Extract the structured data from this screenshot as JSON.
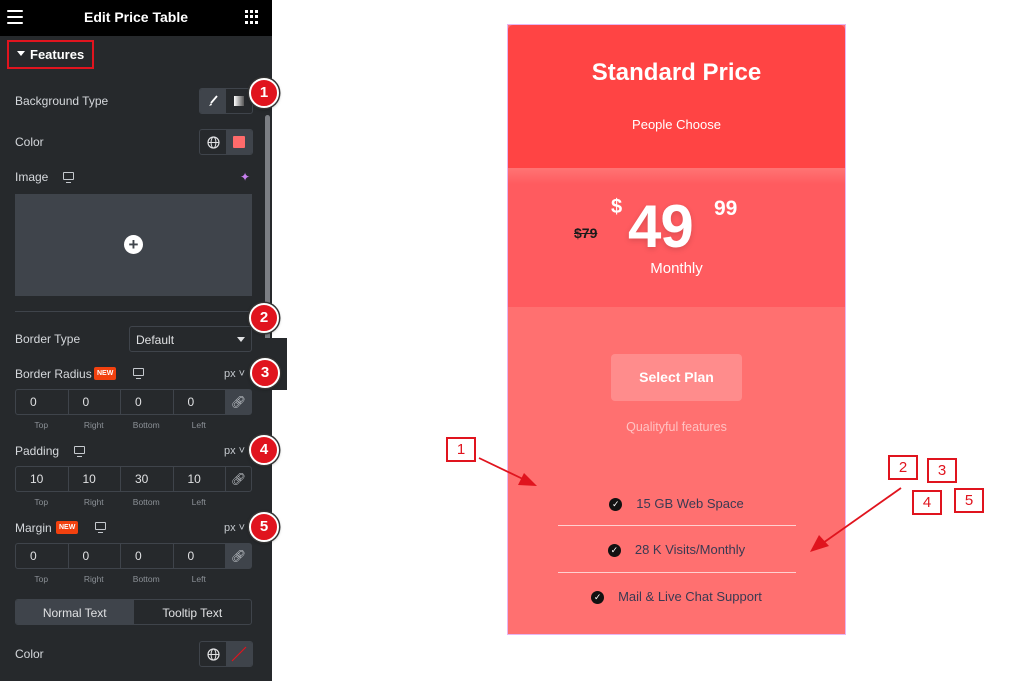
{
  "panel": {
    "header": {
      "title": "Edit Price Table",
      "menu_icon": "hamburger-icon",
      "apps_icon": "grid-icon"
    },
    "section_title": "Features",
    "background_type": {
      "label": "Background Type",
      "options": [
        "classic-brush-icon",
        "gradient-icon"
      ],
      "selected": "classic"
    },
    "color": {
      "label": "Color",
      "swatch": "#ff6b6b"
    },
    "image": {
      "label": "Image",
      "add_icon": "plus-circle-icon"
    },
    "border_type": {
      "label": "Border Type",
      "value": "Default"
    },
    "border_radius": {
      "label": "Border Radius",
      "badge": "NEW",
      "unit": "px",
      "values": [
        "0",
        "0",
        "0",
        "0"
      ],
      "sides": [
        "Top",
        "Right",
        "Bottom",
        "Left"
      ]
    },
    "padding": {
      "label": "Padding",
      "unit": "px",
      "values": [
        "10",
        "10",
        "30",
        "10"
      ],
      "sides": [
        "Top",
        "Right",
        "Bottom",
        "Left"
      ]
    },
    "margin": {
      "label": "Margin",
      "badge": "NEW",
      "unit": "px",
      "values": [
        "0",
        "0",
        "0",
        "0"
      ],
      "sides": [
        "Top",
        "Right",
        "Bottom",
        "Left"
      ]
    },
    "tabs": [
      "Normal Text",
      "Tooltip Text"
    ],
    "active_tab": "Normal Text",
    "text_color": {
      "label": "Color"
    }
  },
  "annotations": {
    "circles": [
      "1",
      "2",
      "3",
      "4",
      "5"
    ],
    "boxes": [
      "1",
      "2",
      "3",
      "4",
      "5"
    ]
  },
  "card": {
    "title": "Standard Price",
    "subtitle": "People Choose",
    "old_price": "$79",
    "currency": "$",
    "amount": "49",
    "cents": "99",
    "period": "Monthly",
    "button": "Select Plan",
    "features_title": "Qualityful features",
    "features": [
      "15 GB Web Space",
      "28 K Visits/Monthly",
      "Mail & Live Chat Support"
    ],
    "colors": {
      "header": "#ff4444",
      "price": "#ff5b5f",
      "body": "#ff7070"
    }
  }
}
